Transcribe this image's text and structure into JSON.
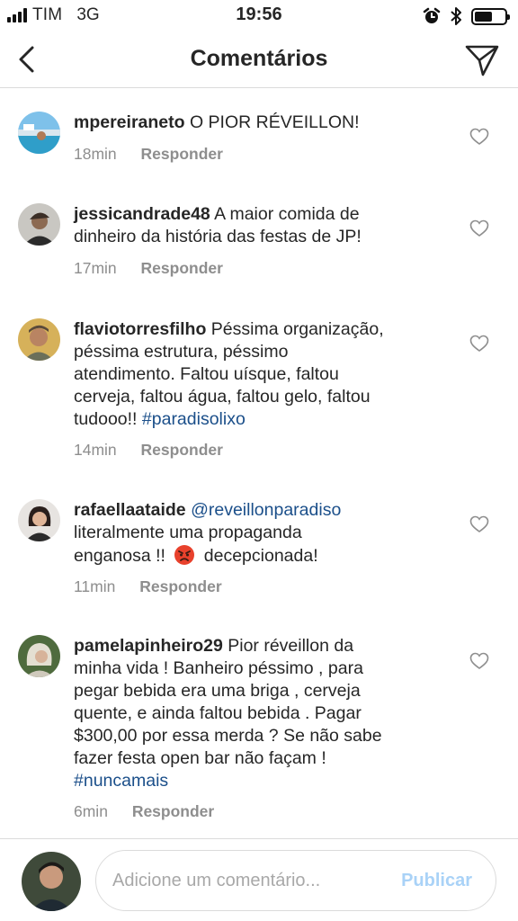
{
  "status_bar": {
    "carrier": "TIM",
    "network": "3G",
    "time": "19:56",
    "battery_level": 0.6,
    "icons": [
      "signal-icon",
      "alarm-icon",
      "bluetooth-icon",
      "battery-icon"
    ]
  },
  "header": {
    "title": "Comentários",
    "back_icon": "chevron-left-icon",
    "send_icon": "paper-plane-icon"
  },
  "comments": [
    {
      "username": "mpereiraneto",
      "lines": [
        "O PIOR RÉVEILLON!"
      ],
      "time": "18min",
      "reply": "Responder"
    },
    {
      "username": "jessicandrade48",
      "lines": [
        "A maior comida de",
        "dinheiro da história das festas de JP!"
      ],
      "time": "17min",
      "reply": "Responder"
    },
    {
      "username": "flaviotorresfilho",
      "lines": [
        "Péssima organização,",
        "péssima estrutura, péssimo",
        "atendimento. Faltou uísque, faltou",
        "cerveja, faltou água, faltou gelo, faltou",
        "tudooo!!"
      ],
      "hashtag": "#paradisolixo",
      "time": "14min",
      "reply": "Responder"
    },
    {
      "username": "rafaellaataide",
      "mention": "@reveillonparadiso",
      "lines": [
        "literalmente uma propaganda",
        "enganosa !!",
        "decepcionada!"
      ],
      "emoji": "angry-face-emoji",
      "time": "11min",
      "reply": "Responder"
    },
    {
      "username": "pamelapinheiro29",
      "lines": [
        "Pior réveillon da",
        "minha vida ! Banheiro péssimo , para",
        "pegar bebida era uma briga , cerveja",
        "quente, e ainda faltou bebida . Pagar",
        "$300,00 por essa merda ? Se não sabe",
        "fazer festa open bar não façam !"
      ],
      "hashtag": "#nuncamais",
      "time": "6min",
      "reply": "Responder"
    }
  ],
  "composer": {
    "placeholder": "Adicione um comentário...",
    "publish_label": "Publicar"
  },
  "colors": {
    "text": "#262626",
    "meta": "#8e8e8e",
    "link": "#1b4f8a",
    "publish_disabled": "#a9d2f7",
    "divider": "#dbdbdb"
  }
}
